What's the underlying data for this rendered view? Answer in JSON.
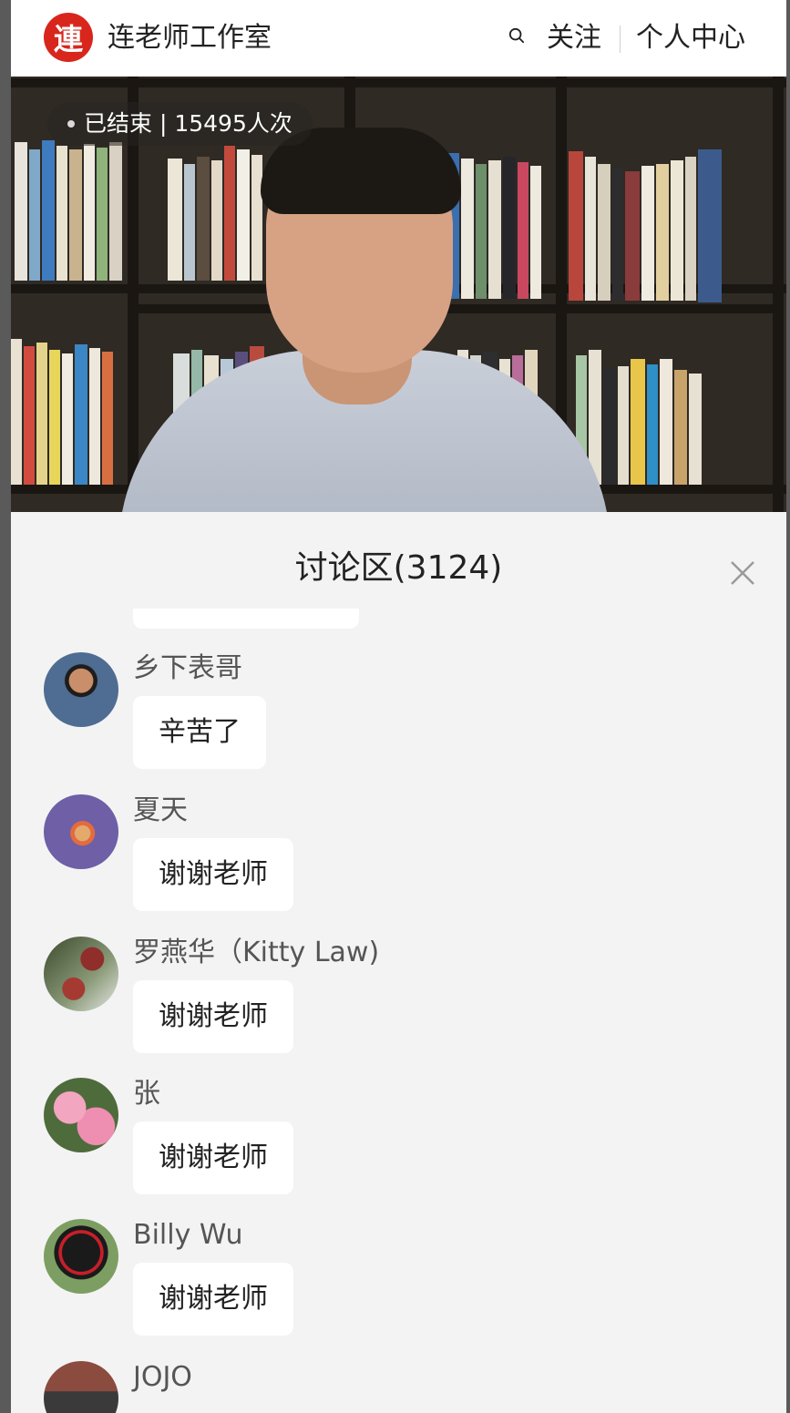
{
  "header": {
    "logo_char": "連",
    "brand": "连老师工作室",
    "search_icon": "search-icon",
    "follow_label": "关注",
    "personal_label": "个人中心"
  },
  "video": {
    "status_text": "已结束 | 15495人次"
  },
  "discussion": {
    "title": "讨论区(3124)",
    "close_icon": "close-icon",
    "comments": [
      {
        "user": "乡下表哥",
        "text": "辛苦了"
      },
      {
        "user": "夏天",
        "text": "谢谢老师"
      },
      {
        "user": "罗燕华（Kitty Law)",
        "text": "谢谢老师"
      },
      {
        "user": "张",
        "text": "谢谢老师"
      },
      {
        "user": "Billy Wu",
        "text": "谢谢老师"
      },
      {
        "user": "JOJO",
        "text": ""
      }
    ]
  },
  "colors": {
    "brand_red": "#d8261c",
    "panel_bg": "#f3f3f3",
    "bubble_bg": "#ffffff"
  }
}
